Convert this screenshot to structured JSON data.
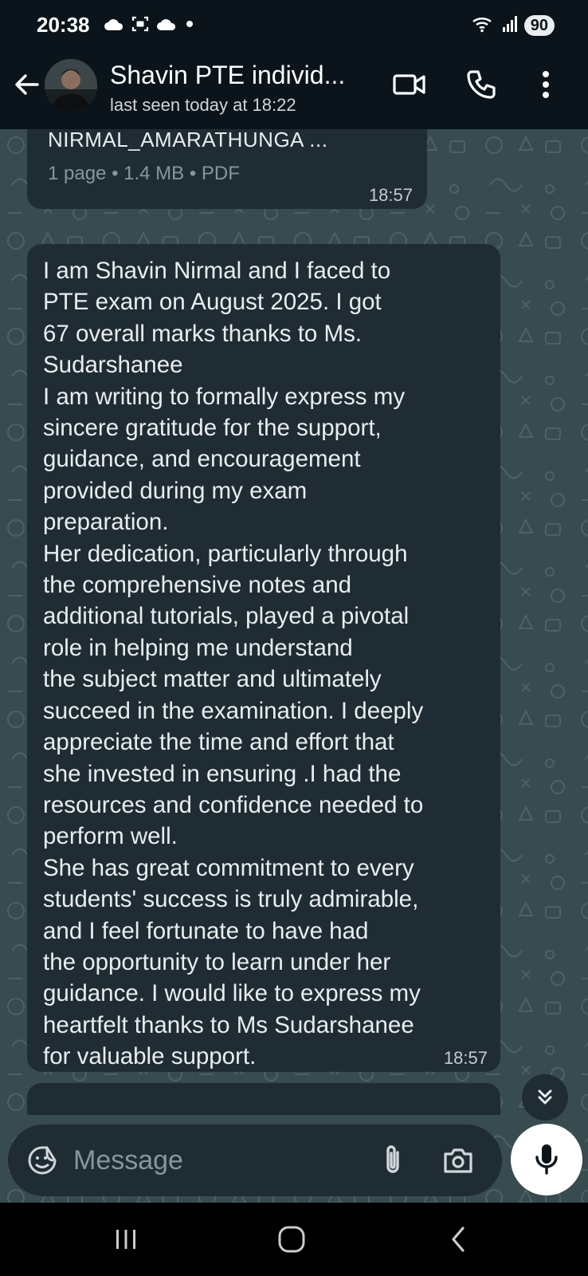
{
  "status_bar": {
    "time": "20:38",
    "battery": "90",
    "left_icons": [
      "cloud-icon",
      "screenshot-icon",
      "cloud-icon",
      "dot-icon"
    ],
    "right_icons": [
      "wifi-icon",
      "signal-icon",
      "battery-icon"
    ]
  },
  "header": {
    "title": "Shavin PTE individ...",
    "subtitle": "last seen today at 18:22",
    "icons": [
      "back-arrow-icon",
      "video-call-icon",
      "voice-call-icon",
      "more-options-icon"
    ]
  },
  "messages": [
    {
      "type": "document",
      "file_name": "NIRMAL_AMARATHUNGA ...",
      "meta": "1 page • 1.4 MB • PDF",
      "time": "18:57"
    },
    {
      "type": "text",
      "lines": [
        "I am Shavin Nirmal and I faced to",
        "PTE exam on August 2025. I got",
        "67 overall marks thanks to Ms.",
        "Sudarshanee",
        "I am writing to formally express my",
        "sincere gratitude for the support,",
        "guidance, and encouragement",
        "provided during my exam",
        "preparation.",
        "Her dedication, particularly through",
        "the comprehensive notes and",
        "additional tutorials, played a pivotal",
        "role in helping me understand",
        "the subject matter and ultimately",
        "succeed in the examination. I deeply",
        "appreciate the time and effort that",
        "she invested in ensuring .I had the",
        "resources and confidence needed to",
        "perform well.",
        "She has great commitment to every",
        "students' success is truly admirable,",
        "and I feel fortunate to have had",
        "the opportunity to learn under her",
        "guidance. I would like to express my",
        "heartfelt thanks to Ms Sudarshanee",
        "for valuable support."
      ],
      "time": "18:57"
    }
  ],
  "input_bar": {
    "placeholder": "Message",
    "icons": [
      "sticker-icon",
      "attach-icon",
      "camera-icon",
      "mic-icon"
    ]
  },
  "scroll_down_icon": "double-chevron-down-icon",
  "nav_bar": {
    "icons": [
      "recent-apps-icon",
      "home-icon",
      "back-icon"
    ]
  },
  "colors": {
    "bar_bg": "#0b141a",
    "chat_bg": "#384b4f",
    "bubble_bg": "#1f2c33",
    "text": "#e9edef",
    "muted": "#8696a0"
  }
}
